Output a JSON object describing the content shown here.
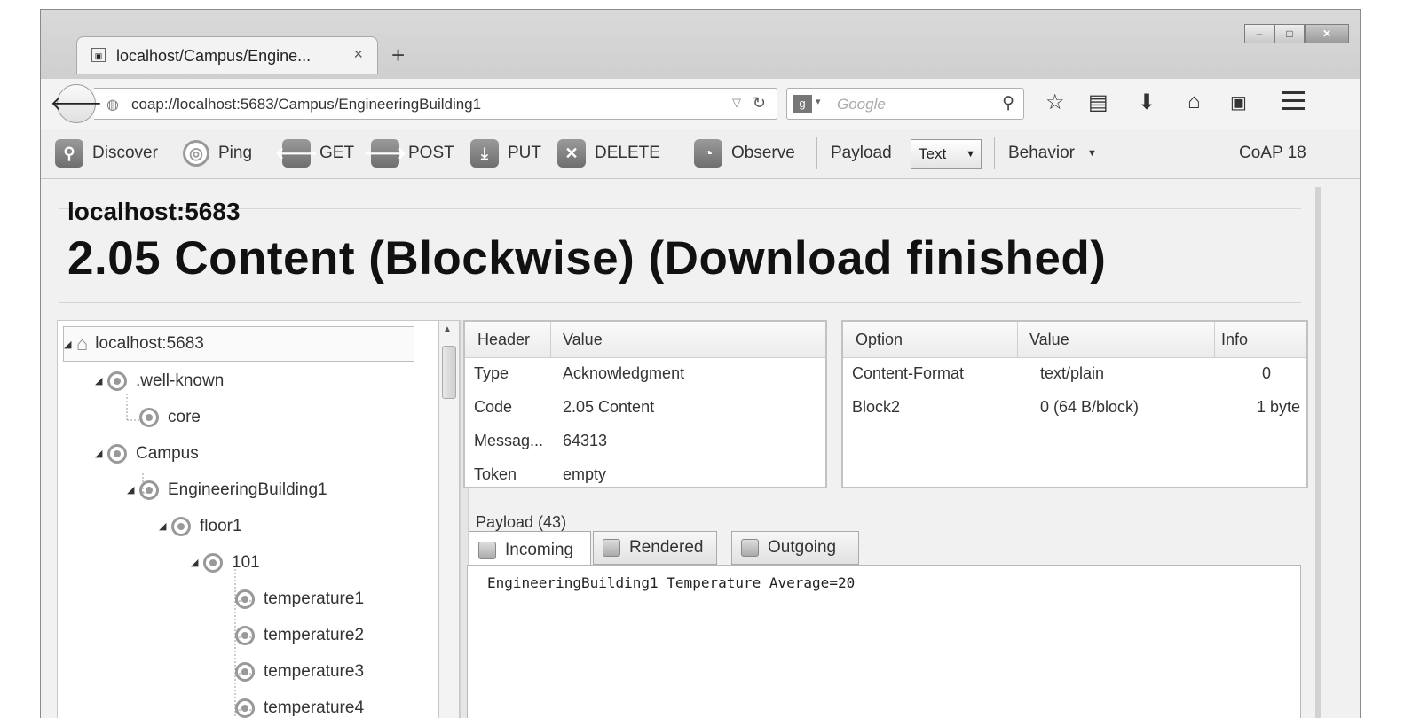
{
  "browser": {
    "tab_title": "localhost/Campus/Engine...",
    "tab_close": "×",
    "new_tab": "+",
    "url": "coap://localhost:5683/Campus/EngineeringBuilding1",
    "search_placeholder": "Google",
    "window_controls": [
      "–",
      "□",
      "✕"
    ]
  },
  "toolbar": {
    "discover": "Discover",
    "ping": "Ping",
    "get": "GET",
    "post": "POST",
    "put": "PUT",
    "delete": "DELETE",
    "observe": "Observe",
    "payload_label": "Payload",
    "payload_format": "Text",
    "behavior": "Behavior",
    "version": "CoAP 18"
  },
  "response": {
    "host": "localhost:5683",
    "status": "2.05 Content (Blockwise) (Download finished)"
  },
  "tree": [
    {
      "label": "localhost:5683",
      "depth": 0,
      "icon": "home-icon",
      "selected": true
    },
    {
      "label": ".well-known",
      "depth": 1,
      "icon": "resource-icon"
    },
    {
      "label": "core",
      "depth": 2,
      "icon": "resource-icon"
    },
    {
      "label": "Campus",
      "depth": 1,
      "icon": "resource-icon"
    },
    {
      "label": "EngineeringBuilding1",
      "depth": 2,
      "icon": "resource-icon"
    },
    {
      "label": "floor1",
      "depth": 3,
      "icon": "resource-icon"
    },
    {
      "label": "101",
      "depth": 4,
      "icon": "resource-icon"
    },
    {
      "label": "temperature1",
      "depth": 5,
      "icon": "resource-icon"
    },
    {
      "label": "temperature2",
      "depth": 5,
      "icon": "resource-icon"
    },
    {
      "label": "temperature3",
      "depth": 5,
      "icon": "resource-icon"
    },
    {
      "label": "temperature4",
      "depth": 5,
      "icon": "resource-icon"
    }
  ],
  "header_table": {
    "columns": [
      "Header",
      "Value"
    ],
    "rows": [
      [
        "Type",
        "Acknowledgment"
      ],
      [
        "Code",
        "2.05 Content"
      ],
      [
        "Messag...",
        "64313"
      ],
      [
        "Token",
        "empty"
      ]
    ]
  },
  "option_table": {
    "columns": [
      "Option",
      "Value",
      "Info"
    ],
    "rows": [
      [
        "Content-Format",
        "text/plain",
        "0"
      ],
      [
        "Block2",
        "0 (64 B/block)",
        "1 byte"
      ]
    ]
  },
  "payload": {
    "label": "Payload (43)",
    "tabs": [
      "Incoming",
      "Rendered",
      "Outgoing"
    ],
    "text": "EngineeringBuilding1 Temperature Average=20"
  }
}
